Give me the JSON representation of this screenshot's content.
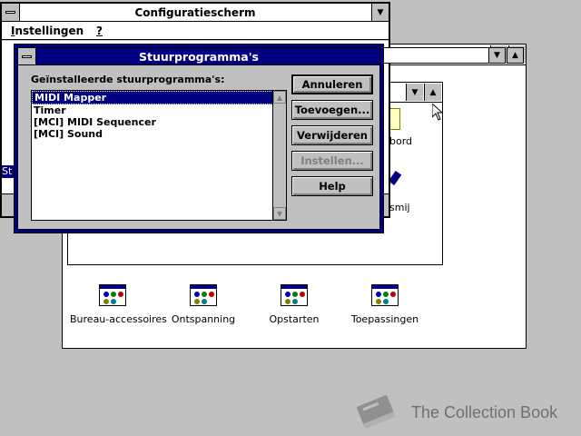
{
  "control_panel": {
    "title": "Configuratiescherm",
    "menu": [
      "Instellingen",
      "?"
    ],
    "partial_item": "St"
  },
  "program_manager": {
    "partial_labels": [
      "bord",
      "smij"
    ]
  },
  "groups": [
    {
      "label": "Bureau-accessoires",
      "icon": "program-group-icon"
    },
    {
      "label": "Ontspanning",
      "icon": "program-group-icon"
    },
    {
      "label": "Opstarten",
      "icon": "program-group-icon"
    },
    {
      "label": "Toepassingen",
      "icon": "program-group-icon"
    }
  ],
  "dialog": {
    "title": "Stuurprogramma's",
    "list_label": "Geïnstalleerde stuurprogramma's:",
    "drivers": [
      "MIDI Mapper",
      "Timer",
      "[MCI] MIDI Sequencer",
      "[MCI] Sound"
    ],
    "selected_index": 0,
    "buttons": {
      "cancel": "Annuleren",
      "add": "Toevoegen...",
      "remove": "Verwijderen",
      "setup": "Instellen...",
      "help": "Help"
    }
  },
  "watermark": {
    "text": "The Collection Book",
    "icon": "book-icon"
  }
}
